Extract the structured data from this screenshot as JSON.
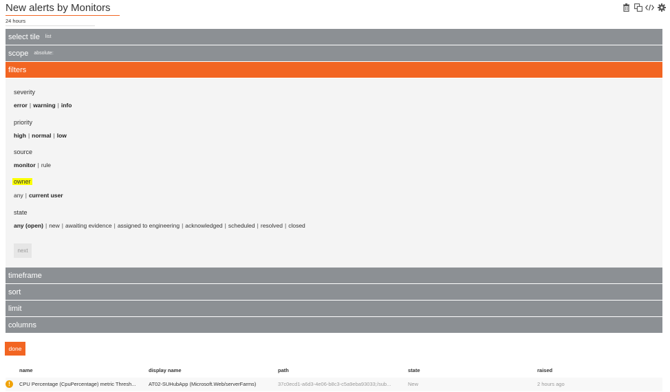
{
  "header": {
    "title": "New alerts by Monitors",
    "subtitle": "24 hours",
    "toolbar": [
      {
        "name": "trash-icon"
      },
      {
        "name": "copy-icon"
      },
      {
        "name": "code-icon"
      },
      {
        "name": "gear-icon"
      }
    ]
  },
  "sections": {
    "select_tile": {
      "label": "select tile",
      "sub": "list"
    },
    "scope": {
      "label": "scope",
      "sub": "absolute:"
    },
    "filters": {
      "label": "filters"
    },
    "timeframe": {
      "label": "timeframe"
    },
    "sort": {
      "label": "sort"
    },
    "limit": {
      "label": "limit"
    },
    "columns": {
      "label": "columns"
    }
  },
  "filters": {
    "severity": {
      "label": "severity",
      "options": [
        "error",
        "warning",
        "info"
      ]
    },
    "priority": {
      "label": "priority",
      "options": [
        "high",
        "normal",
        "low"
      ]
    },
    "source": {
      "label": "source",
      "options": [
        "monitor",
        "rule"
      ]
    },
    "owner": {
      "label": "owner",
      "options": [
        "any",
        "current user"
      ]
    },
    "state": {
      "label": "state",
      "options": [
        "any (open)",
        "new",
        "awaiting evidence",
        "assigned to engineering",
        "acknowledged",
        "scheduled",
        "resolved",
        "closed"
      ]
    },
    "next_label": "next"
  },
  "done_label": "done",
  "table": {
    "columns": [
      "name",
      "display name",
      "path",
      "state",
      "raised"
    ],
    "rows": [
      {
        "name": "CPU Percentage (CpuPercentage) metric Thresh...",
        "display_name": "AT02-SUHubApp (Microsoft.Web/serverFarms)",
        "path": "37c0ecd1-a6d3-4e06-b8c3-c5a9eba93033;/sub...",
        "state": "New",
        "raised": "2 hours ago"
      }
    ]
  },
  "colors": {
    "accent": "#f26522",
    "bar": "#8c9094",
    "panel_bg": "#f4f4f4",
    "highlight": "#fbff00",
    "warning": "#f0a30a"
  }
}
